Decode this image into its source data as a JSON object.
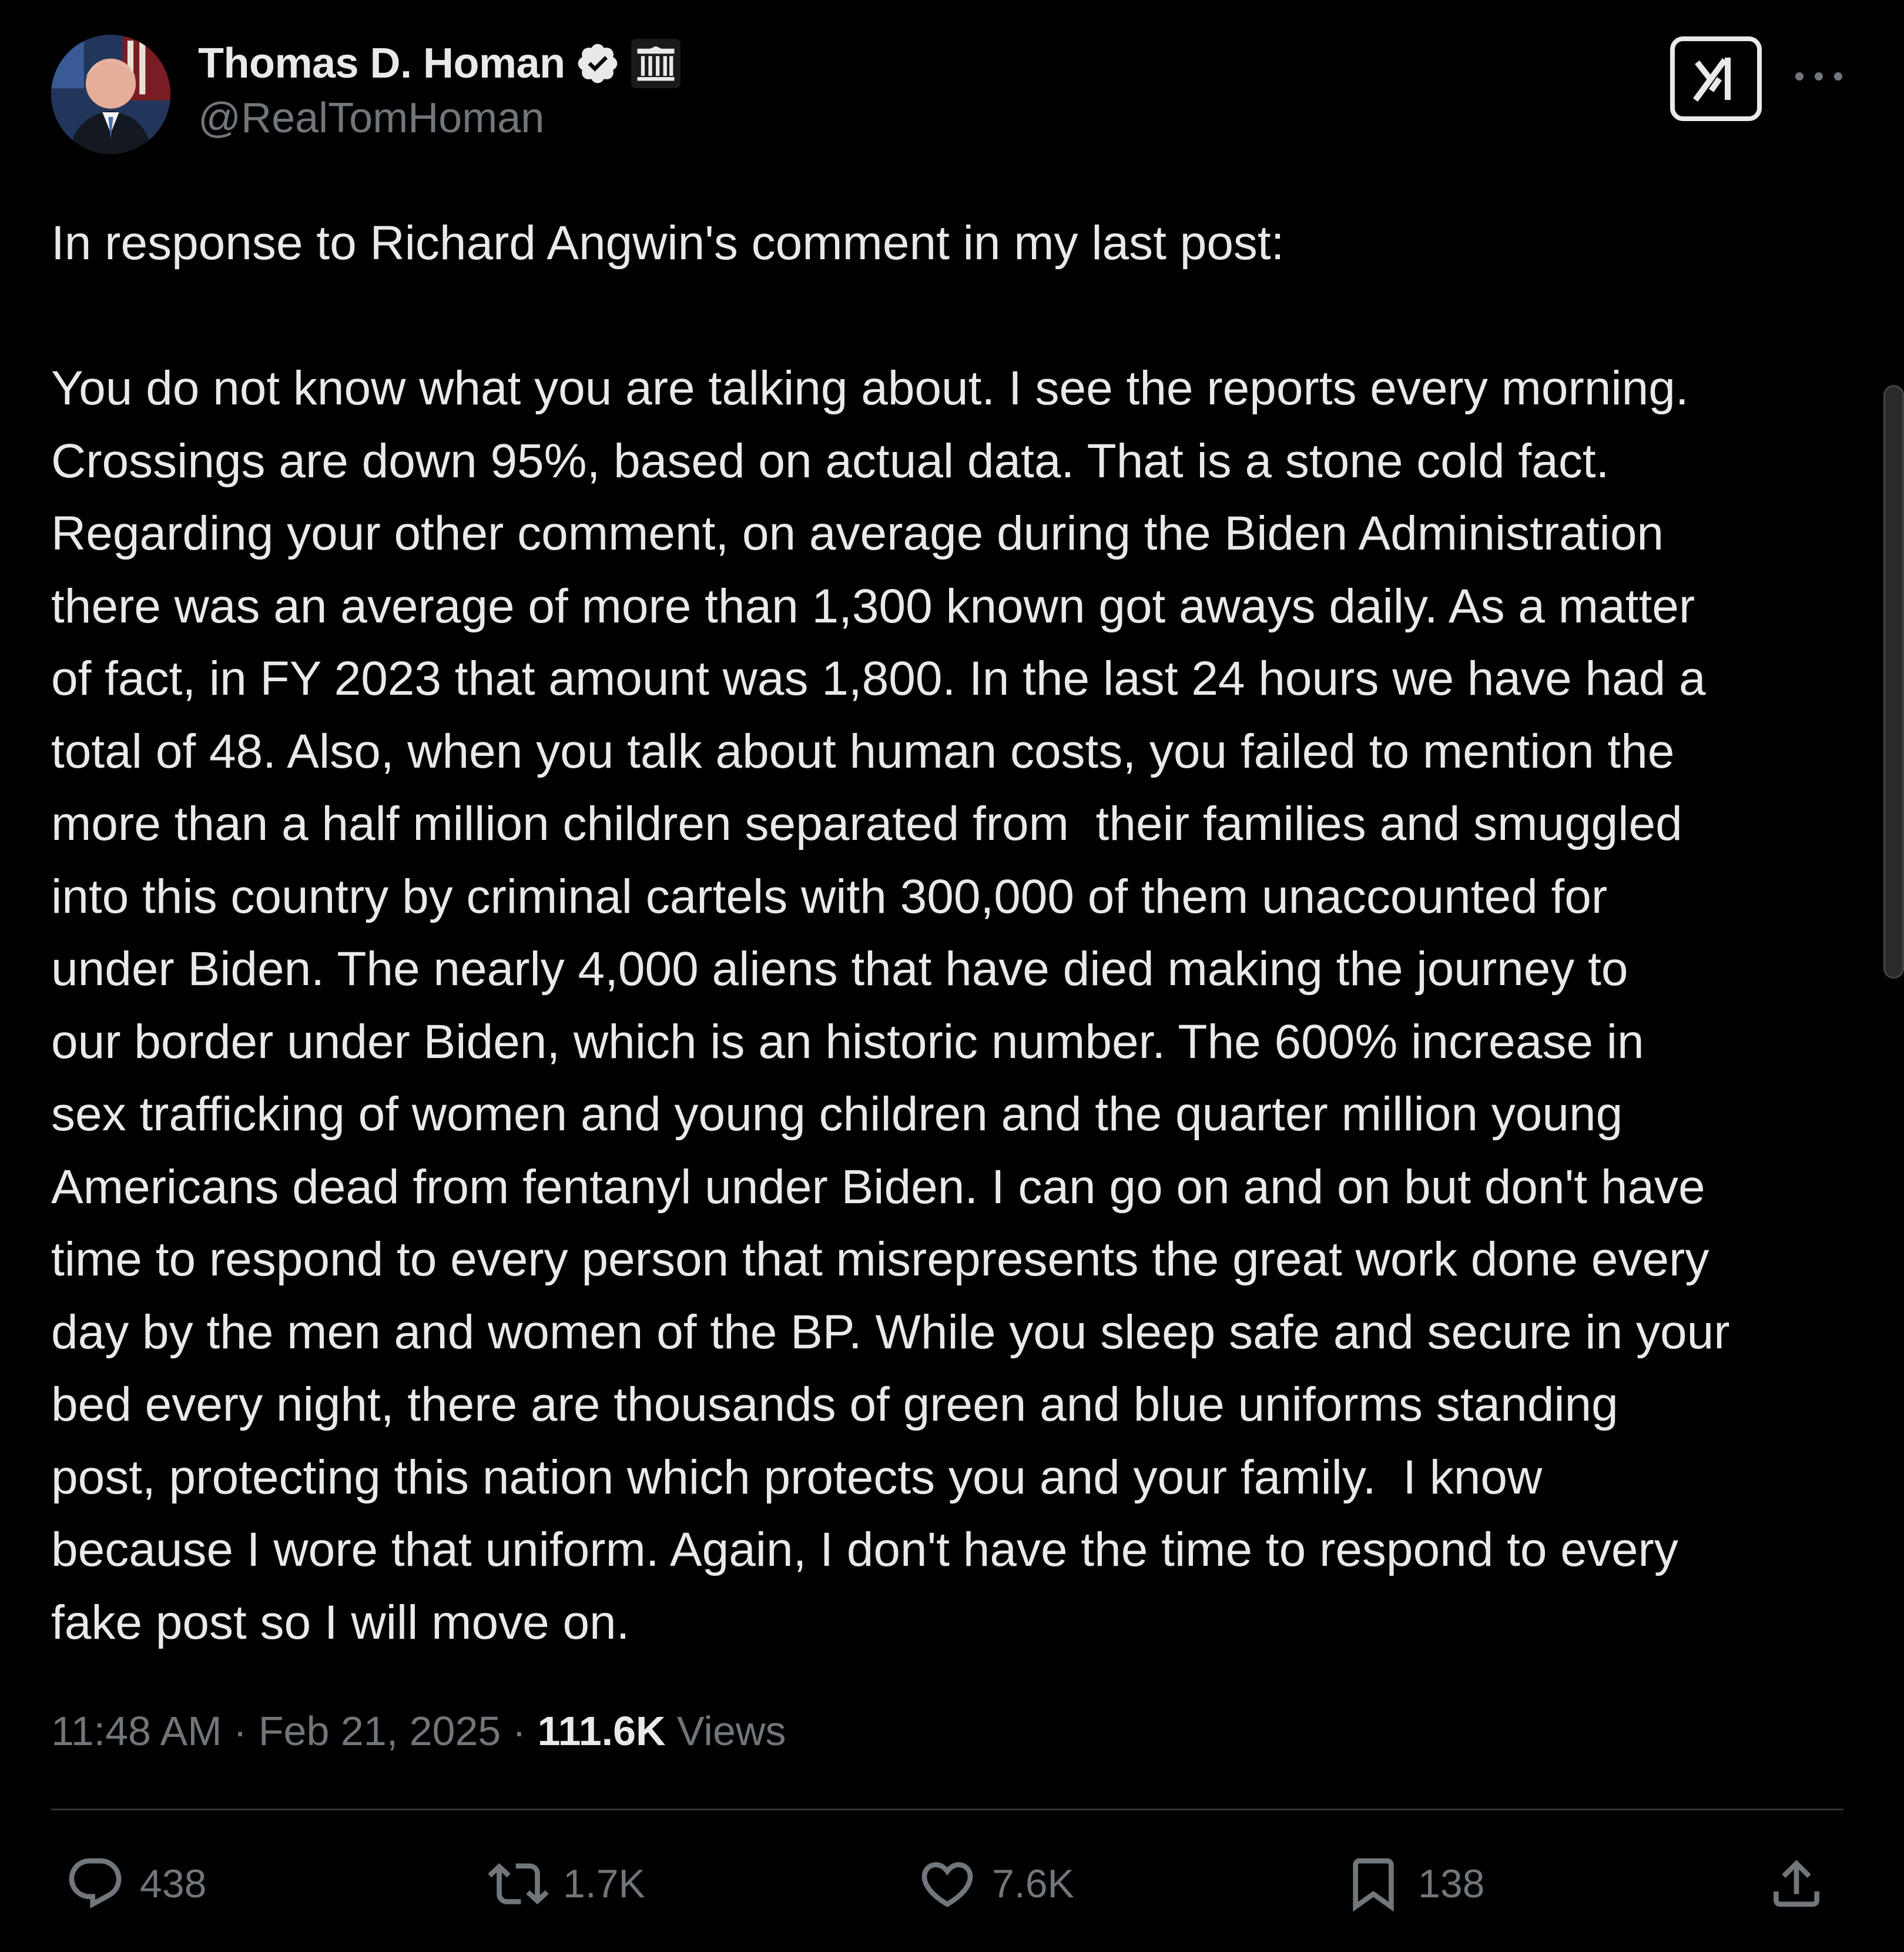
{
  "author": {
    "display_name": "Thomas D. Homan",
    "handle": "@RealTomHoman",
    "verified_icon": "verified-badge-icon",
    "affiliation_icon": "government-building-icon"
  },
  "header": {
    "grok_icon": "grok-icon",
    "more_icon": "more-options-icon"
  },
  "post": {
    "text": "In response to Richard Angwin's comment in my last post:\n\nYou do not know what you are talking about. I see the reports every morning.\nCrossings are down 95%, based on actual data. That is a stone cold fact.\nRegarding your other comment, on average during the Biden Administration\nthere was an average of more than 1,300 known got aways daily. As a matter\nof fact, in FY 2023 that amount was 1,800. In the last 24 hours we have had a\ntotal of 48. Also, when you talk about human costs, you failed to mention the\nmore than a half million children separated from  their families and smuggled\ninto this country by criminal cartels with 300,000 of them unaccounted for\nunder Biden. The nearly 4,000 aliens that have died making the journey to\nour border under Biden, which is an historic number. The 600% increase in\nsex trafficking of women and young children and the quarter million young\nAmericans dead from fentanyl under Biden. I can go on and on but don't have\ntime to respond to every person that misrepresents the great work done every\nday by the men and women of the BP. While you sleep safe and secure in your\nbed every night, there are thousands of green and blue uniforms standing\npost, protecting this nation which protects you and your family.  I know\nbecause I wore that uniform. Again, I don't have the time to respond to every\nfake post so I will move on."
  },
  "meta": {
    "time": "11:48 AM",
    "separator": " · ",
    "date": "Feb 21, 2025",
    "views_count": "111.6K",
    "views_label": " Views"
  },
  "actions": {
    "replies": "438",
    "reposts": "1.7K",
    "likes": "7.6K",
    "bookmarks": "138"
  },
  "colors": {
    "background": "#000000",
    "text": "#e7e9ea",
    "secondary": "#71767b",
    "verified": "#1d9bf0"
  }
}
